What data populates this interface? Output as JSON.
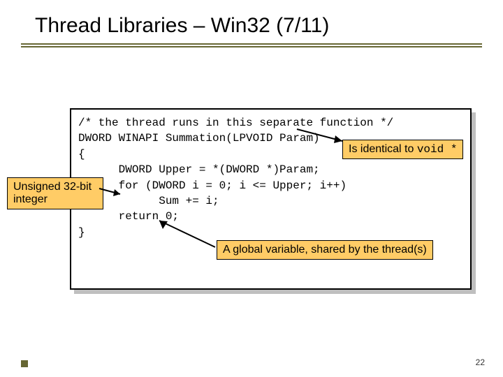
{
  "title": "Thread Libraries – Win32 (7/11)",
  "code": {
    "l1": "/* the thread runs in this separate function */",
    "l2": "DWORD WINAPI Summation(LPVOID Param)",
    "l3": "{",
    "l4": "      DWORD Upper = *(DWORD *)Param;",
    "l5": "",
    "l6": "      for (DWORD i = 0; i <= Upper; i++)",
    "l7": "            Sum += i;",
    "l8": "",
    "l9": "      return 0;",
    "l10": "}"
  },
  "callouts": {
    "left": "Unsigned 32-bit integer",
    "right_prefix": "Is identical to ",
    "right_code": "void *",
    "bottom": "A global variable, shared by the thread(s)"
  },
  "page_number": "22"
}
